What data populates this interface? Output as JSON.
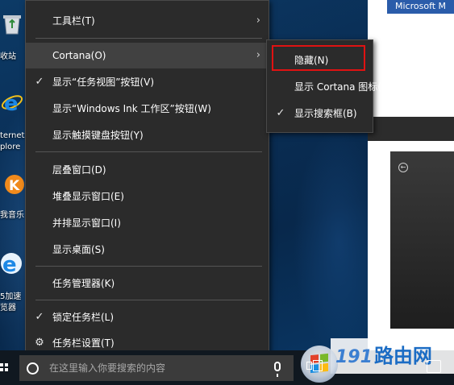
{
  "desktop": {
    "icons": [
      {
        "name": "recycle-bin",
        "label": "收站"
      },
      {
        "name": "internet-explorer",
        "label": "ternet"
      },
      {
        "name": "internet-explorer-sub",
        "label": "plore"
      },
      {
        "name": "kuwo-music",
        "label": "我音乐"
      },
      {
        "name": "ie-accelerated",
        "label": "5加速"
      },
      {
        "name": "ie-accelerated-sub",
        "label": "览器"
      }
    ]
  },
  "background_window": {
    "title": "Microsoft M"
  },
  "context_menu": {
    "items": [
      {
        "label": "工具栏(T)",
        "checked": false,
        "submenu": true
      },
      {
        "label": "Cortana(O)",
        "checked": false,
        "submenu": true
      },
      {
        "label": "显示“任务视图”按钮(V)",
        "checked": true,
        "submenu": false
      },
      {
        "label": "显示“Windows Ink 工作区”按钮(W)",
        "checked": false,
        "submenu": false
      },
      {
        "label": "显示触摸键盘按钮(Y)",
        "checked": false,
        "submenu": false
      },
      {
        "label": "层叠窗口(D)",
        "checked": false,
        "submenu": false
      },
      {
        "label": "堆叠显示窗口(E)",
        "checked": false,
        "submenu": false
      },
      {
        "label": "并排显示窗口(I)",
        "checked": false,
        "submenu": false
      },
      {
        "label": "显示桌面(S)",
        "checked": false,
        "submenu": false
      },
      {
        "label": "任务管理器(K)",
        "checked": false,
        "submenu": false
      },
      {
        "label": "锁定任务栏(L)",
        "checked": true,
        "submenu": false
      },
      {
        "label": "任务栏设置(T)",
        "checked": false,
        "submenu": false
      }
    ],
    "check_glyph": "✓",
    "arrow_glyph": "›"
  },
  "cortana_submenu": {
    "items": [
      {
        "label": "隐藏(N)",
        "checked": false
      },
      {
        "label": "显示 Cortana 图标(W)",
        "checked": false
      },
      {
        "label": "显示搜索框(B)",
        "checked": true
      }
    ],
    "highlight_color": "#e01212"
  },
  "taskbar": {
    "search_placeholder": "在这里输入你要搜索的内容"
  },
  "watermark": {
    "number": "191",
    "text": "路由网"
  },
  "colors": {
    "menu_bg": "#2b2b2b",
    "menu_hover": "#414141",
    "taskbar_bg": "#101820",
    "title_blue": "#2a5caa"
  }
}
